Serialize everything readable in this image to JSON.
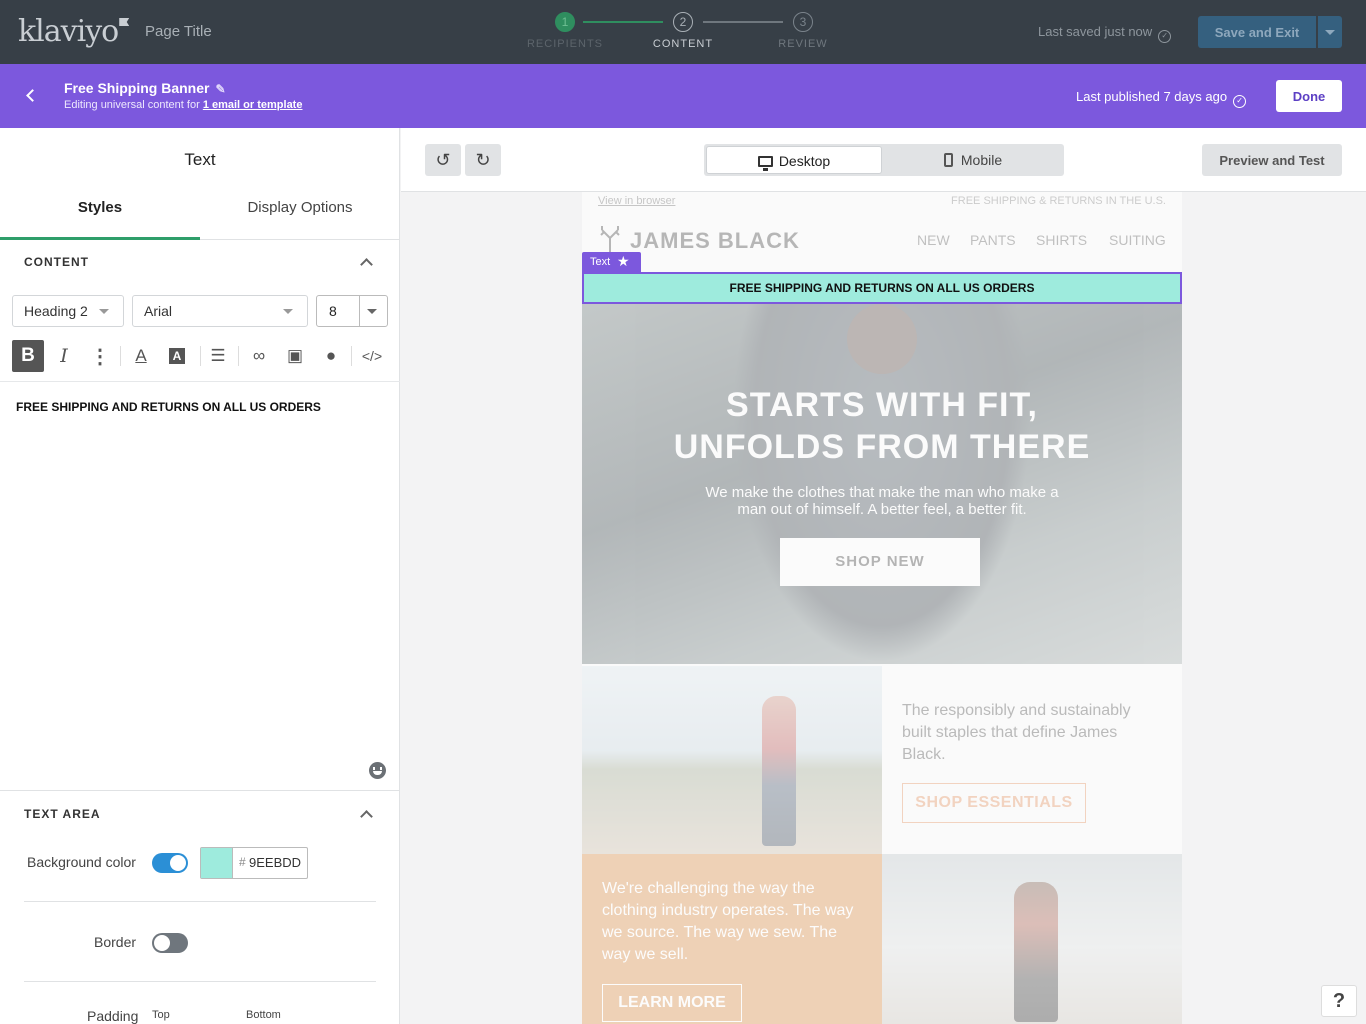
{
  "app": {
    "logo": "klaviyo",
    "page_title": "Page Title"
  },
  "steps": [
    {
      "num": "1",
      "label": "RECIPIENTS"
    },
    {
      "num": "2",
      "label": "CONTENT"
    },
    {
      "num": "3",
      "label": "REVIEW"
    }
  ],
  "header": {
    "saved_text": "Last saved just now",
    "save_exit_label": "Save and Exit"
  },
  "block": {
    "name": "Free Shipping Banner",
    "editing_prefix": "Editing universal content for ",
    "editing_link": "1 email or template",
    "published_text": "Last published 7 days ago",
    "done_label": "Done"
  },
  "panel": {
    "title": "Text",
    "tabs": [
      "Styles",
      "Display Options"
    ],
    "content_section": "CONTENT",
    "style_select": "Heading 2",
    "font_select": "Arial",
    "font_size": "8",
    "content_text": "FREE SHIPPING AND RETURNS ON ALL US ORDERS",
    "text_area_section": "TEXT AREA",
    "bg_color_label": "Background color",
    "bg_color_hex": "9EEBDD",
    "hash": "#",
    "border_label": "Border",
    "padding_label": "Padding",
    "padding_top": "Top",
    "padding_bottom": "Bottom"
  },
  "canvas": {
    "desktop_label": "Desktop",
    "mobile_label": "Mobile",
    "preview_label": "Preview and Test"
  },
  "email": {
    "view_in_browser": "View in browser",
    "top_shipping": "FREE SHIPPING & RETURNS IN THE U.S.",
    "brand": "JAMES BLACK",
    "nav": [
      "NEW",
      "PANTS",
      "SHIRTS",
      "SUITING"
    ],
    "tag_label": "Text",
    "banner_text": "FREE SHIPPING AND RETURNS ON ALL US ORDERS",
    "hero_title_1": "STARTS WITH FIT,",
    "hero_title_2": "UNFOLDS FROM THERE",
    "hero_sub": "We make the clothes that make the man who make a man out of himself. A better feel, a better fit.",
    "hero_cta": "SHOP NEW",
    "copy1": "The responsibly and sustainably built staples that define James Black.",
    "cta2": "SHOP ESSENTIALS",
    "copy2": "We're challenging the way the clothing industry operates. The way we source. The way we sew. The way we sell.",
    "cta3": "LEARN MORE"
  },
  "help": "?",
  "colors": {
    "purple": "#7c58dd",
    "topbar": "#373f47",
    "banner_bg": "#9eebdd",
    "accent_green": "#2f9e6a",
    "toggle_blue": "#2b8fd6",
    "orange": "#d78438"
  }
}
